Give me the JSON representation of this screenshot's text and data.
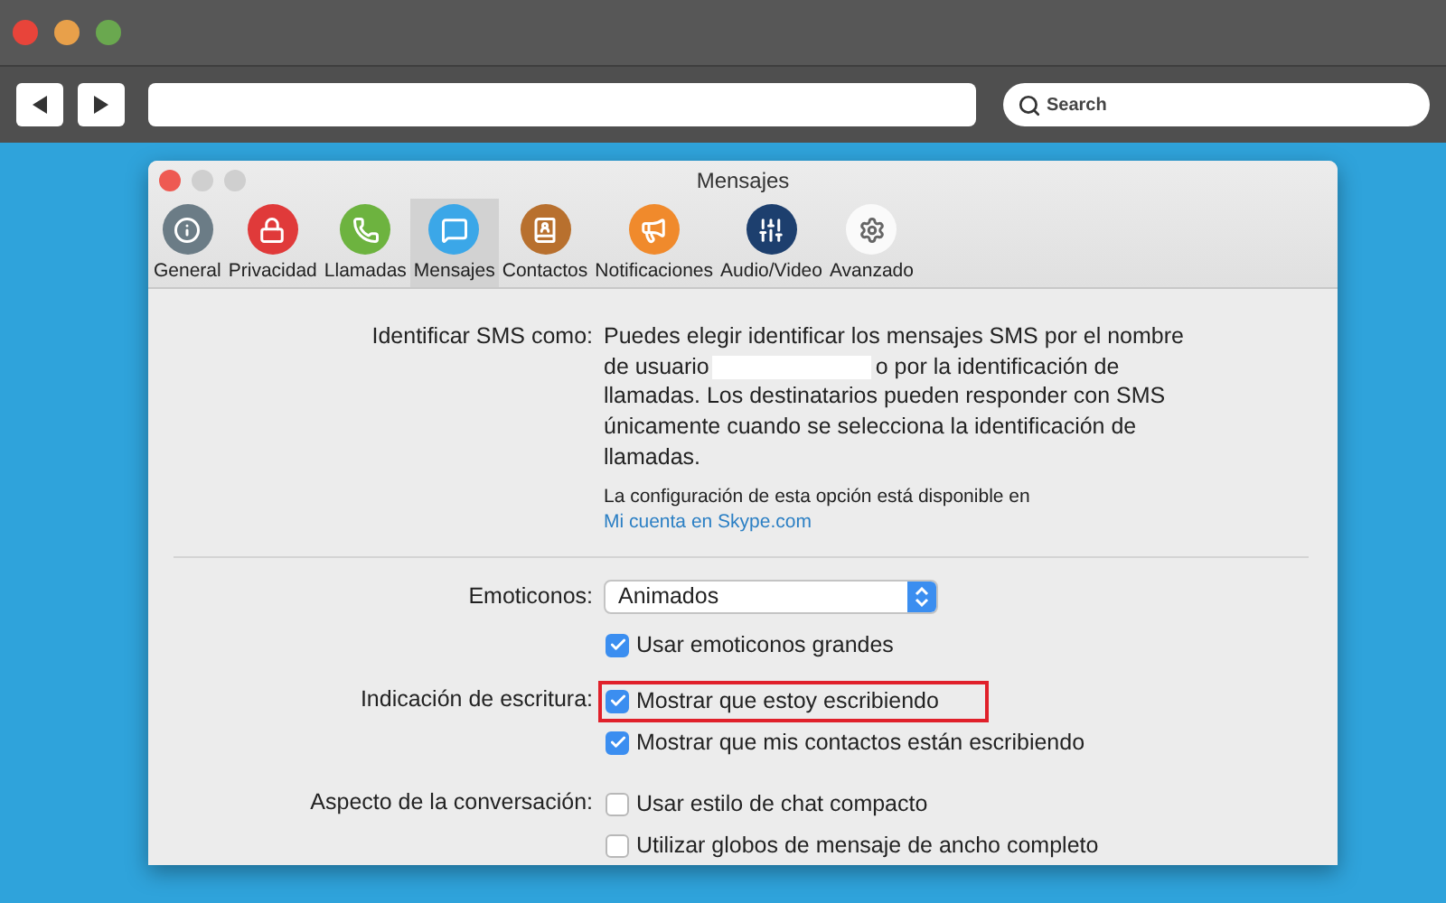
{
  "browser": {
    "search": {
      "placeholder": "Search"
    }
  },
  "window": {
    "title": "Mensajes"
  },
  "tabs": [
    {
      "label": "General",
      "kind": "info",
      "selected": false
    },
    {
      "label": "Privacidad",
      "kind": "lock",
      "selected": false
    },
    {
      "label": "Llamadas",
      "kind": "phone",
      "selected": false
    },
    {
      "label": "Mensajes",
      "kind": "message",
      "selected": true
    },
    {
      "label": "Contactos",
      "kind": "contacts",
      "selected": false
    },
    {
      "label": "Notificaciones",
      "kind": "megaphone",
      "selected": false
    },
    {
      "label": "Audio/Video",
      "kind": "sliders",
      "selected": false
    },
    {
      "label": "Avanzado",
      "kind": "gear",
      "selected": false
    }
  ],
  "sms": {
    "label": "Identificar SMS como:",
    "text_before": "Puedes elegir identificar los mensajes SMS por el nombre de usuario",
    "text_after": "o por la identificación de llamadas. Los destinatarios pueden responder con SMS únicamente cuando se selecciona la identificación de llamadas.",
    "note": "La configuración de esta opción está disponible en",
    "note_link": "Mi cuenta en Skype.com"
  },
  "emoticons": {
    "label": "Emoticonos:",
    "value": "Animados",
    "options": [
      {
        "label": "Usar emoticonos grandes",
        "checked": true,
        "highlighted": false
      }
    ]
  },
  "typing": {
    "label": "Indicación de escritura:",
    "options": [
      {
        "label": "Mostrar que estoy escribiendo",
        "checked": true,
        "highlighted": true
      },
      {
        "label": "Mostrar que mis contactos están escribiendo",
        "checked": true,
        "highlighted": false
      }
    ]
  },
  "appearance": {
    "label": "Aspecto de la conversación:",
    "options": [
      {
        "label": "Usar estilo de chat compacto",
        "checked": false,
        "highlighted": false
      },
      {
        "label": "Utilizar globos de mensaje de ancho completo",
        "checked": false,
        "highlighted": false
      }
    ]
  }
}
